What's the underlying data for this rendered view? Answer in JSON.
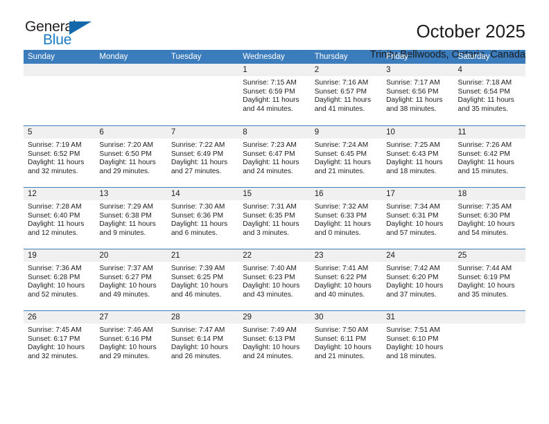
{
  "brand": {
    "name_top": "General",
    "name_bottom": "Blue",
    "accent_color": "#1b7ac4",
    "triangle_color": "#1368ab"
  },
  "header": {
    "title": "October 2025",
    "subtitle": "Trinity-Bellwoods, Ontario, Canada"
  },
  "calendar": {
    "header_bg": "#3b7cbd",
    "daynum_bg": "#f0f0f0",
    "weekdays": [
      "Sunday",
      "Monday",
      "Tuesday",
      "Wednesday",
      "Thursday",
      "Friday",
      "Saturday"
    ],
    "weeks": [
      [
        {
          "day": "",
          "empty": true
        },
        {
          "day": "",
          "empty": true
        },
        {
          "day": "",
          "empty": true
        },
        {
          "day": "1",
          "sunrise": "Sunrise: 7:15 AM",
          "sunset": "Sunset: 6:59 PM",
          "daylight1": "Daylight: 11 hours",
          "daylight2": "and 44 minutes."
        },
        {
          "day": "2",
          "sunrise": "Sunrise: 7:16 AM",
          "sunset": "Sunset: 6:57 PM",
          "daylight1": "Daylight: 11 hours",
          "daylight2": "and 41 minutes."
        },
        {
          "day": "3",
          "sunrise": "Sunrise: 7:17 AM",
          "sunset": "Sunset: 6:56 PM",
          "daylight1": "Daylight: 11 hours",
          "daylight2": "and 38 minutes."
        },
        {
          "day": "4",
          "sunrise": "Sunrise: 7:18 AM",
          "sunset": "Sunset: 6:54 PM",
          "daylight1": "Daylight: 11 hours",
          "daylight2": "and 35 minutes."
        }
      ],
      [
        {
          "day": "5",
          "sunrise": "Sunrise: 7:19 AM",
          "sunset": "Sunset: 6:52 PM",
          "daylight1": "Daylight: 11 hours",
          "daylight2": "and 32 minutes."
        },
        {
          "day": "6",
          "sunrise": "Sunrise: 7:20 AM",
          "sunset": "Sunset: 6:50 PM",
          "daylight1": "Daylight: 11 hours",
          "daylight2": "and 29 minutes."
        },
        {
          "day": "7",
          "sunrise": "Sunrise: 7:22 AM",
          "sunset": "Sunset: 6:49 PM",
          "daylight1": "Daylight: 11 hours",
          "daylight2": "and 27 minutes."
        },
        {
          "day": "8",
          "sunrise": "Sunrise: 7:23 AM",
          "sunset": "Sunset: 6:47 PM",
          "daylight1": "Daylight: 11 hours",
          "daylight2": "and 24 minutes."
        },
        {
          "day": "9",
          "sunrise": "Sunrise: 7:24 AM",
          "sunset": "Sunset: 6:45 PM",
          "daylight1": "Daylight: 11 hours",
          "daylight2": "and 21 minutes."
        },
        {
          "day": "10",
          "sunrise": "Sunrise: 7:25 AM",
          "sunset": "Sunset: 6:43 PM",
          "daylight1": "Daylight: 11 hours",
          "daylight2": "and 18 minutes."
        },
        {
          "day": "11",
          "sunrise": "Sunrise: 7:26 AM",
          "sunset": "Sunset: 6:42 PM",
          "daylight1": "Daylight: 11 hours",
          "daylight2": "and 15 minutes."
        }
      ],
      [
        {
          "day": "12",
          "sunrise": "Sunrise: 7:28 AM",
          "sunset": "Sunset: 6:40 PM",
          "daylight1": "Daylight: 11 hours",
          "daylight2": "and 12 minutes."
        },
        {
          "day": "13",
          "sunrise": "Sunrise: 7:29 AM",
          "sunset": "Sunset: 6:38 PM",
          "daylight1": "Daylight: 11 hours",
          "daylight2": "and 9 minutes."
        },
        {
          "day": "14",
          "sunrise": "Sunrise: 7:30 AM",
          "sunset": "Sunset: 6:36 PM",
          "daylight1": "Daylight: 11 hours",
          "daylight2": "and 6 minutes."
        },
        {
          "day": "15",
          "sunrise": "Sunrise: 7:31 AM",
          "sunset": "Sunset: 6:35 PM",
          "daylight1": "Daylight: 11 hours",
          "daylight2": "and 3 minutes."
        },
        {
          "day": "16",
          "sunrise": "Sunrise: 7:32 AM",
          "sunset": "Sunset: 6:33 PM",
          "daylight1": "Daylight: 11 hours",
          "daylight2": "and 0 minutes."
        },
        {
          "day": "17",
          "sunrise": "Sunrise: 7:34 AM",
          "sunset": "Sunset: 6:31 PM",
          "daylight1": "Daylight: 10 hours",
          "daylight2": "and 57 minutes."
        },
        {
          "day": "18",
          "sunrise": "Sunrise: 7:35 AM",
          "sunset": "Sunset: 6:30 PM",
          "daylight1": "Daylight: 10 hours",
          "daylight2": "and 54 minutes."
        }
      ],
      [
        {
          "day": "19",
          "sunrise": "Sunrise: 7:36 AM",
          "sunset": "Sunset: 6:28 PM",
          "daylight1": "Daylight: 10 hours",
          "daylight2": "and 52 minutes."
        },
        {
          "day": "20",
          "sunrise": "Sunrise: 7:37 AM",
          "sunset": "Sunset: 6:27 PM",
          "daylight1": "Daylight: 10 hours",
          "daylight2": "and 49 minutes."
        },
        {
          "day": "21",
          "sunrise": "Sunrise: 7:39 AM",
          "sunset": "Sunset: 6:25 PM",
          "daylight1": "Daylight: 10 hours",
          "daylight2": "and 46 minutes."
        },
        {
          "day": "22",
          "sunrise": "Sunrise: 7:40 AM",
          "sunset": "Sunset: 6:23 PM",
          "daylight1": "Daylight: 10 hours",
          "daylight2": "and 43 minutes."
        },
        {
          "day": "23",
          "sunrise": "Sunrise: 7:41 AM",
          "sunset": "Sunset: 6:22 PM",
          "daylight1": "Daylight: 10 hours",
          "daylight2": "and 40 minutes."
        },
        {
          "day": "24",
          "sunrise": "Sunrise: 7:42 AM",
          "sunset": "Sunset: 6:20 PM",
          "daylight1": "Daylight: 10 hours",
          "daylight2": "and 37 minutes."
        },
        {
          "day": "25",
          "sunrise": "Sunrise: 7:44 AM",
          "sunset": "Sunset: 6:19 PM",
          "daylight1": "Daylight: 10 hours",
          "daylight2": "and 35 minutes."
        }
      ],
      [
        {
          "day": "26",
          "sunrise": "Sunrise: 7:45 AM",
          "sunset": "Sunset: 6:17 PM",
          "daylight1": "Daylight: 10 hours",
          "daylight2": "and 32 minutes."
        },
        {
          "day": "27",
          "sunrise": "Sunrise: 7:46 AM",
          "sunset": "Sunset: 6:16 PM",
          "daylight1": "Daylight: 10 hours",
          "daylight2": "and 29 minutes."
        },
        {
          "day": "28",
          "sunrise": "Sunrise: 7:47 AM",
          "sunset": "Sunset: 6:14 PM",
          "daylight1": "Daylight: 10 hours",
          "daylight2": "and 26 minutes."
        },
        {
          "day": "29",
          "sunrise": "Sunrise: 7:49 AM",
          "sunset": "Sunset: 6:13 PM",
          "daylight1": "Daylight: 10 hours",
          "daylight2": "and 24 minutes."
        },
        {
          "day": "30",
          "sunrise": "Sunrise: 7:50 AM",
          "sunset": "Sunset: 6:11 PM",
          "daylight1": "Daylight: 10 hours",
          "daylight2": "and 21 minutes."
        },
        {
          "day": "31",
          "sunrise": "Sunrise: 7:51 AM",
          "sunset": "Sunset: 6:10 PM",
          "daylight1": "Daylight: 10 hours",
          "daylight2": "and 18 minutes."
        },
        {
          "day": "",
          "empty": true
        }
      ]
    ]
  }
}
